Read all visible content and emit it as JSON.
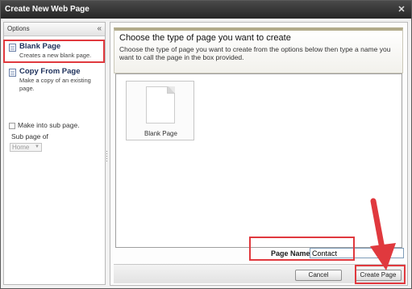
{
  "window": {
    "title": "Create New Web Page"
  },
  "sidebar": {
    "header": "Options",
    "collapse_glyph": "«",
    "options": [
      {
        "title": "Blank Page",
        "description": "Creates a new blank page.",
        "icon": "page-icon"
      },
      {
        "title": "Copy From Page",
        "description": "Make a copy of an existing page.",
        "icon": "page-icon"
      }
    ],
    "sub_page_checkbox": "Make into sub page.",
    "sub_page_of_label": "Sub page of",
    "sub_page_select": {
      "value": "Home"
    }
  },
  "main": {
    "title": "Choose the type of page you want to create",
    "description": "Choose the type of page you want to create from the options below then type a name you want to call the page in the box provided.",
    "tiles": [
      {
        "label": "Blank Page",
        "icon": "blank-document-icon"
      }
    ],
    "page_name": {
      "label": "Page Name",
      "value": "Contact"
    },
    "buttons": {
      "cancel": "Cancel",
      "create": "Create Page"
    }
  },
  "annotations": {
    "highlight_color": "#e0393e"
  }
}
